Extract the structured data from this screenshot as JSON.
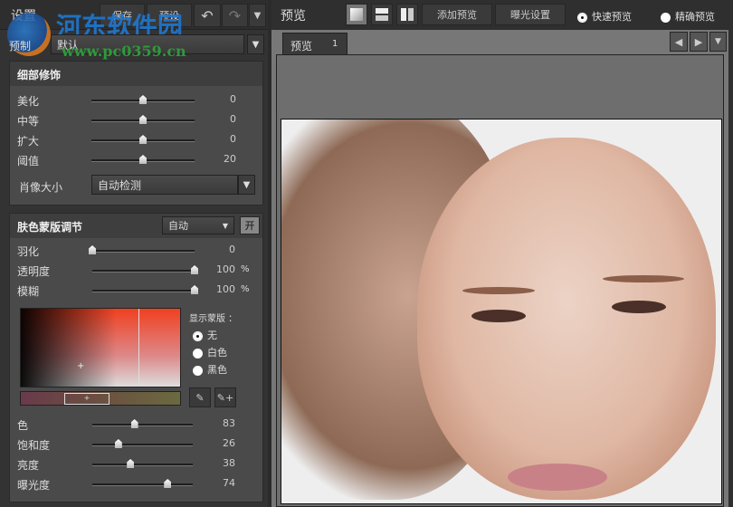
{
  "watermark": {
    "title": "河东软件园",
    "url": "www.pc0359.cn"
  },
  "left": {
    "title": "设置",
    "save": "保存",
    "preset_btn": "预设",
    "preset_label": "预制",
    "preset_value": "默认",
    "detail": {
      "title": "细部修饰",
      "sliders": [
        {
          "label": "美化",
          "value": "0",
          "position": 0.5
        },
        {
          "label": "中等",
          "value": "0",
          "position": 0.5
        },
        {
          "label": "扩大",
          "value": "0",
          "position": 0.5
        },
        {
          "label": "阈值",
          "value": "20",
          "position": 0.5
        }
      ],
      "size_label": "肖像大小",
      "size_value": "自动检测"
    },
    "skin": {
      "title": "肤色蒙版调节",
      "mode": "自动",
      "toggle": "开",
      "sliders": [
        {
          "label": "羽化",
          "value": "0",
          "unit": "",
          "position": 0
        },
        {
          "label": "透明度",
          "value": "100",
          "unit": "%",
          "position": 1
        },
        {
          "label": "模糊",
          "value": "100",
          "unit": "%",
          "position": 1
        }
      ],
      "mask_label": "显示蒙版 ：",
      "mask_options": [
        {
          "label": "无",
          "selected": true
        },
        {
          "label": "白色",
          "selected": false
        },
        {
          "label": "黑色",
          "selected": false
        }
      ],
      "color_sliders": [
        {
          "label": "色",
          "value": "83",
          "position": 0.42
        },
        {
          "label": "饱和度",
          "value": "26",
          "position": 0.26
        },
        {
          "label": "亮度",
          "value": "38",
          "position": 0.38
        },
        {
          "label": "曝光度",
          "value": "74",
          "position": 0.75
        }
      ]
    }
  },
  "right": {
    "title": "预览",
    "add_preview": "添加预览",
    "exposure": "曝光设置",
    "fast": "快速预览",
    "accurate": "精确预览",
    "tab": "预览",
    "tab_num": "1"
  }
}
